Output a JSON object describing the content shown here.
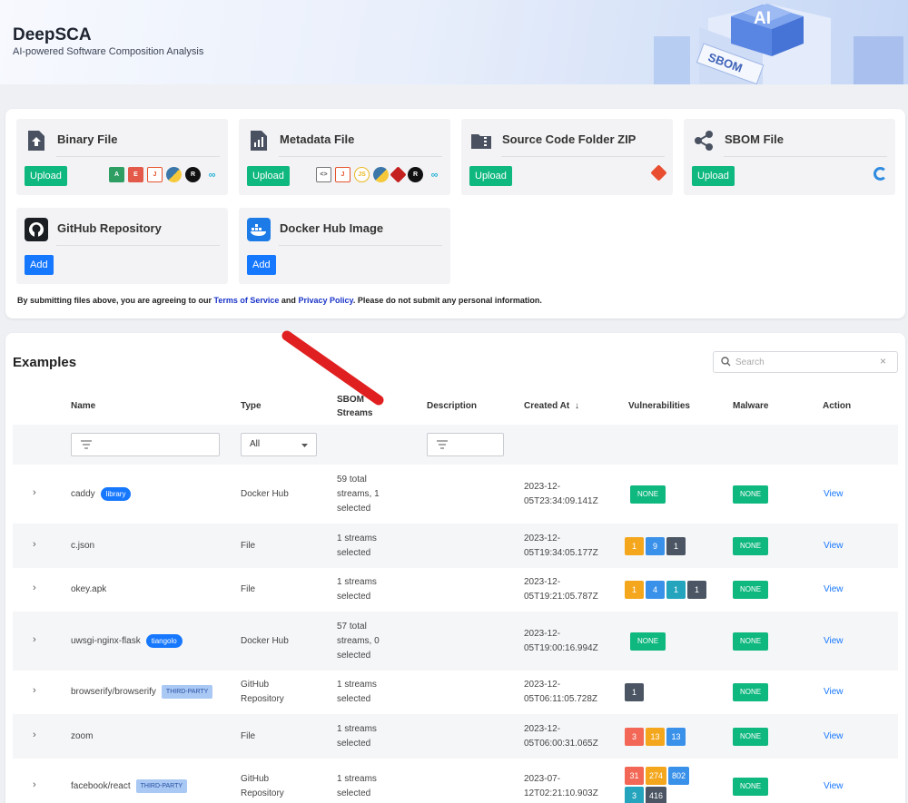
{
  "header": {
    "title": "DeepSCA",
    "subtitle": "AI-powered Software Composition Analysis",
    "hero_badge": "AI",
    "hero_sbom": "SBOM"
  },
  "tiles": [
    {
      "title": "Binary File",
      "button": "Upload",
      "icon": "upload-file-icon"
    },
    {
      "title": "Metadata File",
      "button": "Upload",
      "icon": "bar-chart-file-icon"
    },
    {
      "title": "Source Code Folder ZIP",
      "button": "Upload",
      "icon": "zip-folder-icon"
    },
    {
      "title": "SBOM File",
      "button": "Upload",
      "icon": "share-nodes-icon"
    },
    {
      "title": "GitHub Repository",
      "button": "Add",
      "icon": "github-icon"
    },
    {
      "title": "Docker Hub Image",
      "button": "Add",
      "icon": "docker-icon"
    }
  ],
  "terms": {
    "prefix": "By submitting files above, you are agreeing to our ",
    "tos": "Terms of Service",
    "and": " and ",
    "privacy": "Privacy Policy",
    "suffix": ". Please do not submit any personal information."
  },
  "examples": {
    "title": "Examples",
    "search_placeholder": "Search",
    "columns": {
      "name": "Name",
      "type": "Type",
      "streams_line1": "SBOM",
      "streams_line2": "Streams",
      "description": "Description",
      "created": "Created At",
      "vulns": "Vulnerabilities",
      "malware": "Malware",
      "action": "Action"
    },
    "type_filter": "All",
    "rows": [
      {
        "name": "caddy",
        "tag": "library",
        "type1": "Docker Hub",
        "type2": "",
        "streams": [
          "59 total",
          "streams, 1",
          "selected"
        ],
        "created1": "2023-12-",
        "created2": "05T23:34:09.141Z",
        "vulns": [],
        "vuln_none": "NONE",
        "malware": "NONE",
        "action": "View"
      },
      {
        "name": "c.json",
        "tag": "",
        "type1": "File",
        "type2": "",
        "streams": [
          "1 streams",
          "selected"
        ],
        "created1": "2023-12-",
        "created2": "05T19:34:05.177Z",
        "vulns": [
          {
            "v": "1",
            "c": "orange"
          },
          {
            "v": "9",
            "c": "blue"
          },
          {
            "v": "1",
            "c": "dark"
          }
        ],
        "vuln_none": "",
        "malware": "NONE",
        "action": "View"
      },
      {
        "name": "okey.apk",
        "tag": "",
        "type1": "File",
        "type2": "",
        "streams": [
          "1 streams",
          "selected"
        ],
        "created1": "2023-12-",
        "created2": "05T19:21:05.787Z",
        "vulns": [
          {
            "v": "1",
            "c": "orange"
          },
          {
            "v": "4",
            "c": "blue"
          },
          {
            "v": "1",
            "c": "teal"
          },
          {
            "v": "1",
            "c": "dark"
          }
        ],
        "vuln_none": "",
        "malware": "NONE",
        "action": "View"
      },
      {
        "name": "uwsgi-nginx-flask",
        "tag": "tiangolo",
        "type1": "Docker Hub",
        "type2": "",
        "streams": [
          "57 total",
          "streams, 0",
          "selected"
        ],
        "created1": "2023-12-",
        "created2": "05T19:00:16.994Z",
        "vulns": [],
        "vuln_none": "NONE",
        "malware": "NONE",
        "action": "View"
      },
      {
        "name": "browserify/browserify",
        "tag": "THIRD-PARTY",
        "type1": "GitHub",
        "type2": "Repository",
        "streams": [
          "1 streams",
          "selected"
        ],
        "created1": "2023-12-",
        "created2": "05T06:11:05.728Z",
        "vulns": [
          {
            "v": "1",
            "c": "dark"
          }
        ],
        "vuln_none": "",
        "malware": "NONE",
        "action": "View"
      },
      {
        "name": "zoom",
        "tag": "",
        "type1": "File",
        "type2": "",
        "streams": [
          "1 streams",
          "selected"
        ],
        "created1": "2023-12-",
        "created2": "05T06:00:31.065Z",
        "vulns": [
          {
            "v": "3",
            "c": "red"
          },
          {
            "v": "13",
            "c": "orange"
          },
          {
            "v": "13",
            "c": "blue"
          }
        ],
        "vuln_none": "",
        "malware": "NONE",
        "action": "View"
      },
      {
        "name": "facebook/react",
        "tag": "THIRD-PARTY",
        "type1": "GitHub",
        "type2": "Repository",
        "streams": [
          "1 streams",
          "selected"
        ],
        "created1": "2023-07-",
        "created2": "12T02:21:10.903Z",
        "vulns": [
          {
            "v": "31",
            "c": "red"
          },
          {
            "v": "274",
            "c": "orange"
          },
          {
            "v": "802",
            "c": "blue"
          },
          {
            "v": "3",
            "c": "teal"
          },
          {
            "v": "416",
            "c": "dark"
          }
        ],
        "vuln_none": "",
        "malware": "NONE",
        "action": "View"
      }
    ]
  },
  "colors": {
    "accent_green": "#0fb87f",
    "accent_blue": "#1677ff",
    "annotation_red": "#e02020"
  }
}
